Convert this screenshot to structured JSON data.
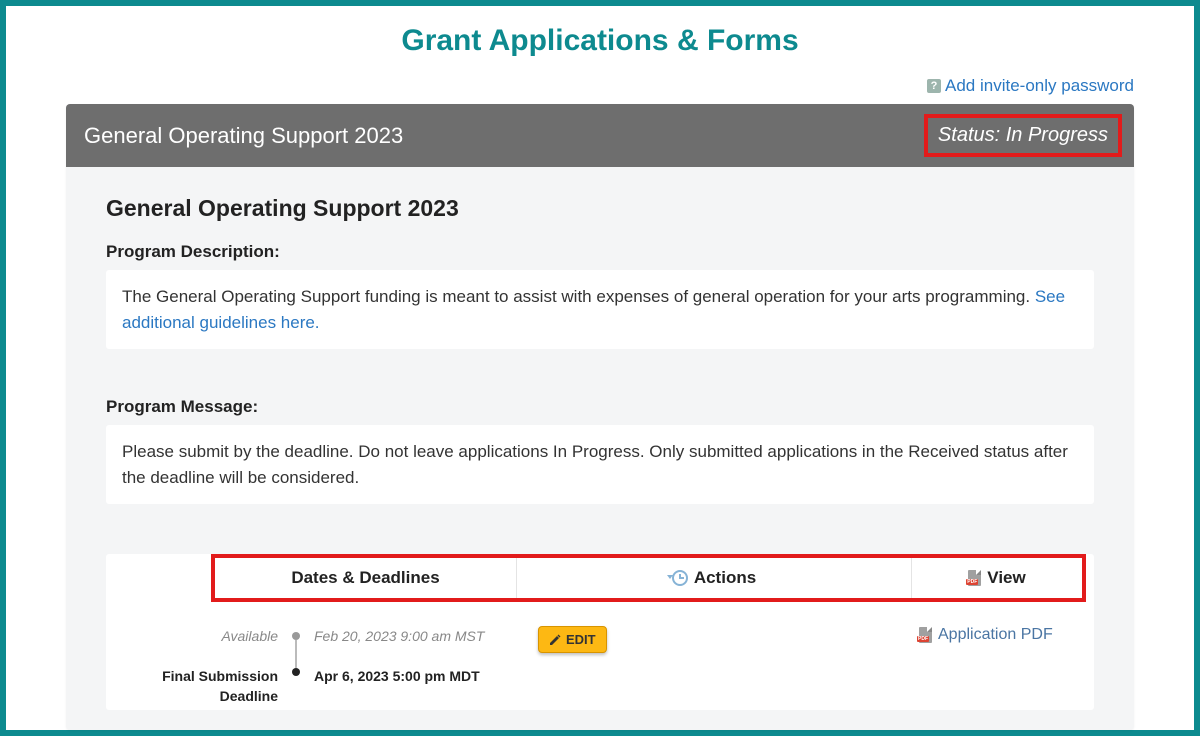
{
  "pageTitle": "Grant Applications & Forms",
  "topLink": {
    "helpBadge": "?",
    "text": "Add invite-only password"
  },
  "card": {
    "headerTitle": "General Operating Support 2023",
    "statusText": "Status: In Progress",
    "subtitle": "General Operating Support 2023",
    "programDescription": {
      "label": "Program Description:",
      "text": "The General Operating Support funding is meant to assist with expenses of general operation for your arts programming.",
      "linkText": "See additional guidelines here."
    },
    "programMessage": {
      "label": "Program Message:",
      "text": "Please submit by the deadline. Do not leave applications In Progress. Only submitted applications in the Received status after the deadline will be considered."
    },
    "table": {
      "headers": {
        "dates": "Dates & Deadlines",
        "actions": "Actions",
        "view": "View"
      },
      "timeline": {
        "availableLabel": "Available",
        "availableDate": "Feb 20, 2023 9:00 am MST",
        "deadlineLabel": "Final Submission Deadline",
        "deadlineDate": "Apr 6, 2023 5:00 pm MDT"
      },
      "editButton": "EDIT",
      "pdfLink": "Application PDF"
    }
  }
}
